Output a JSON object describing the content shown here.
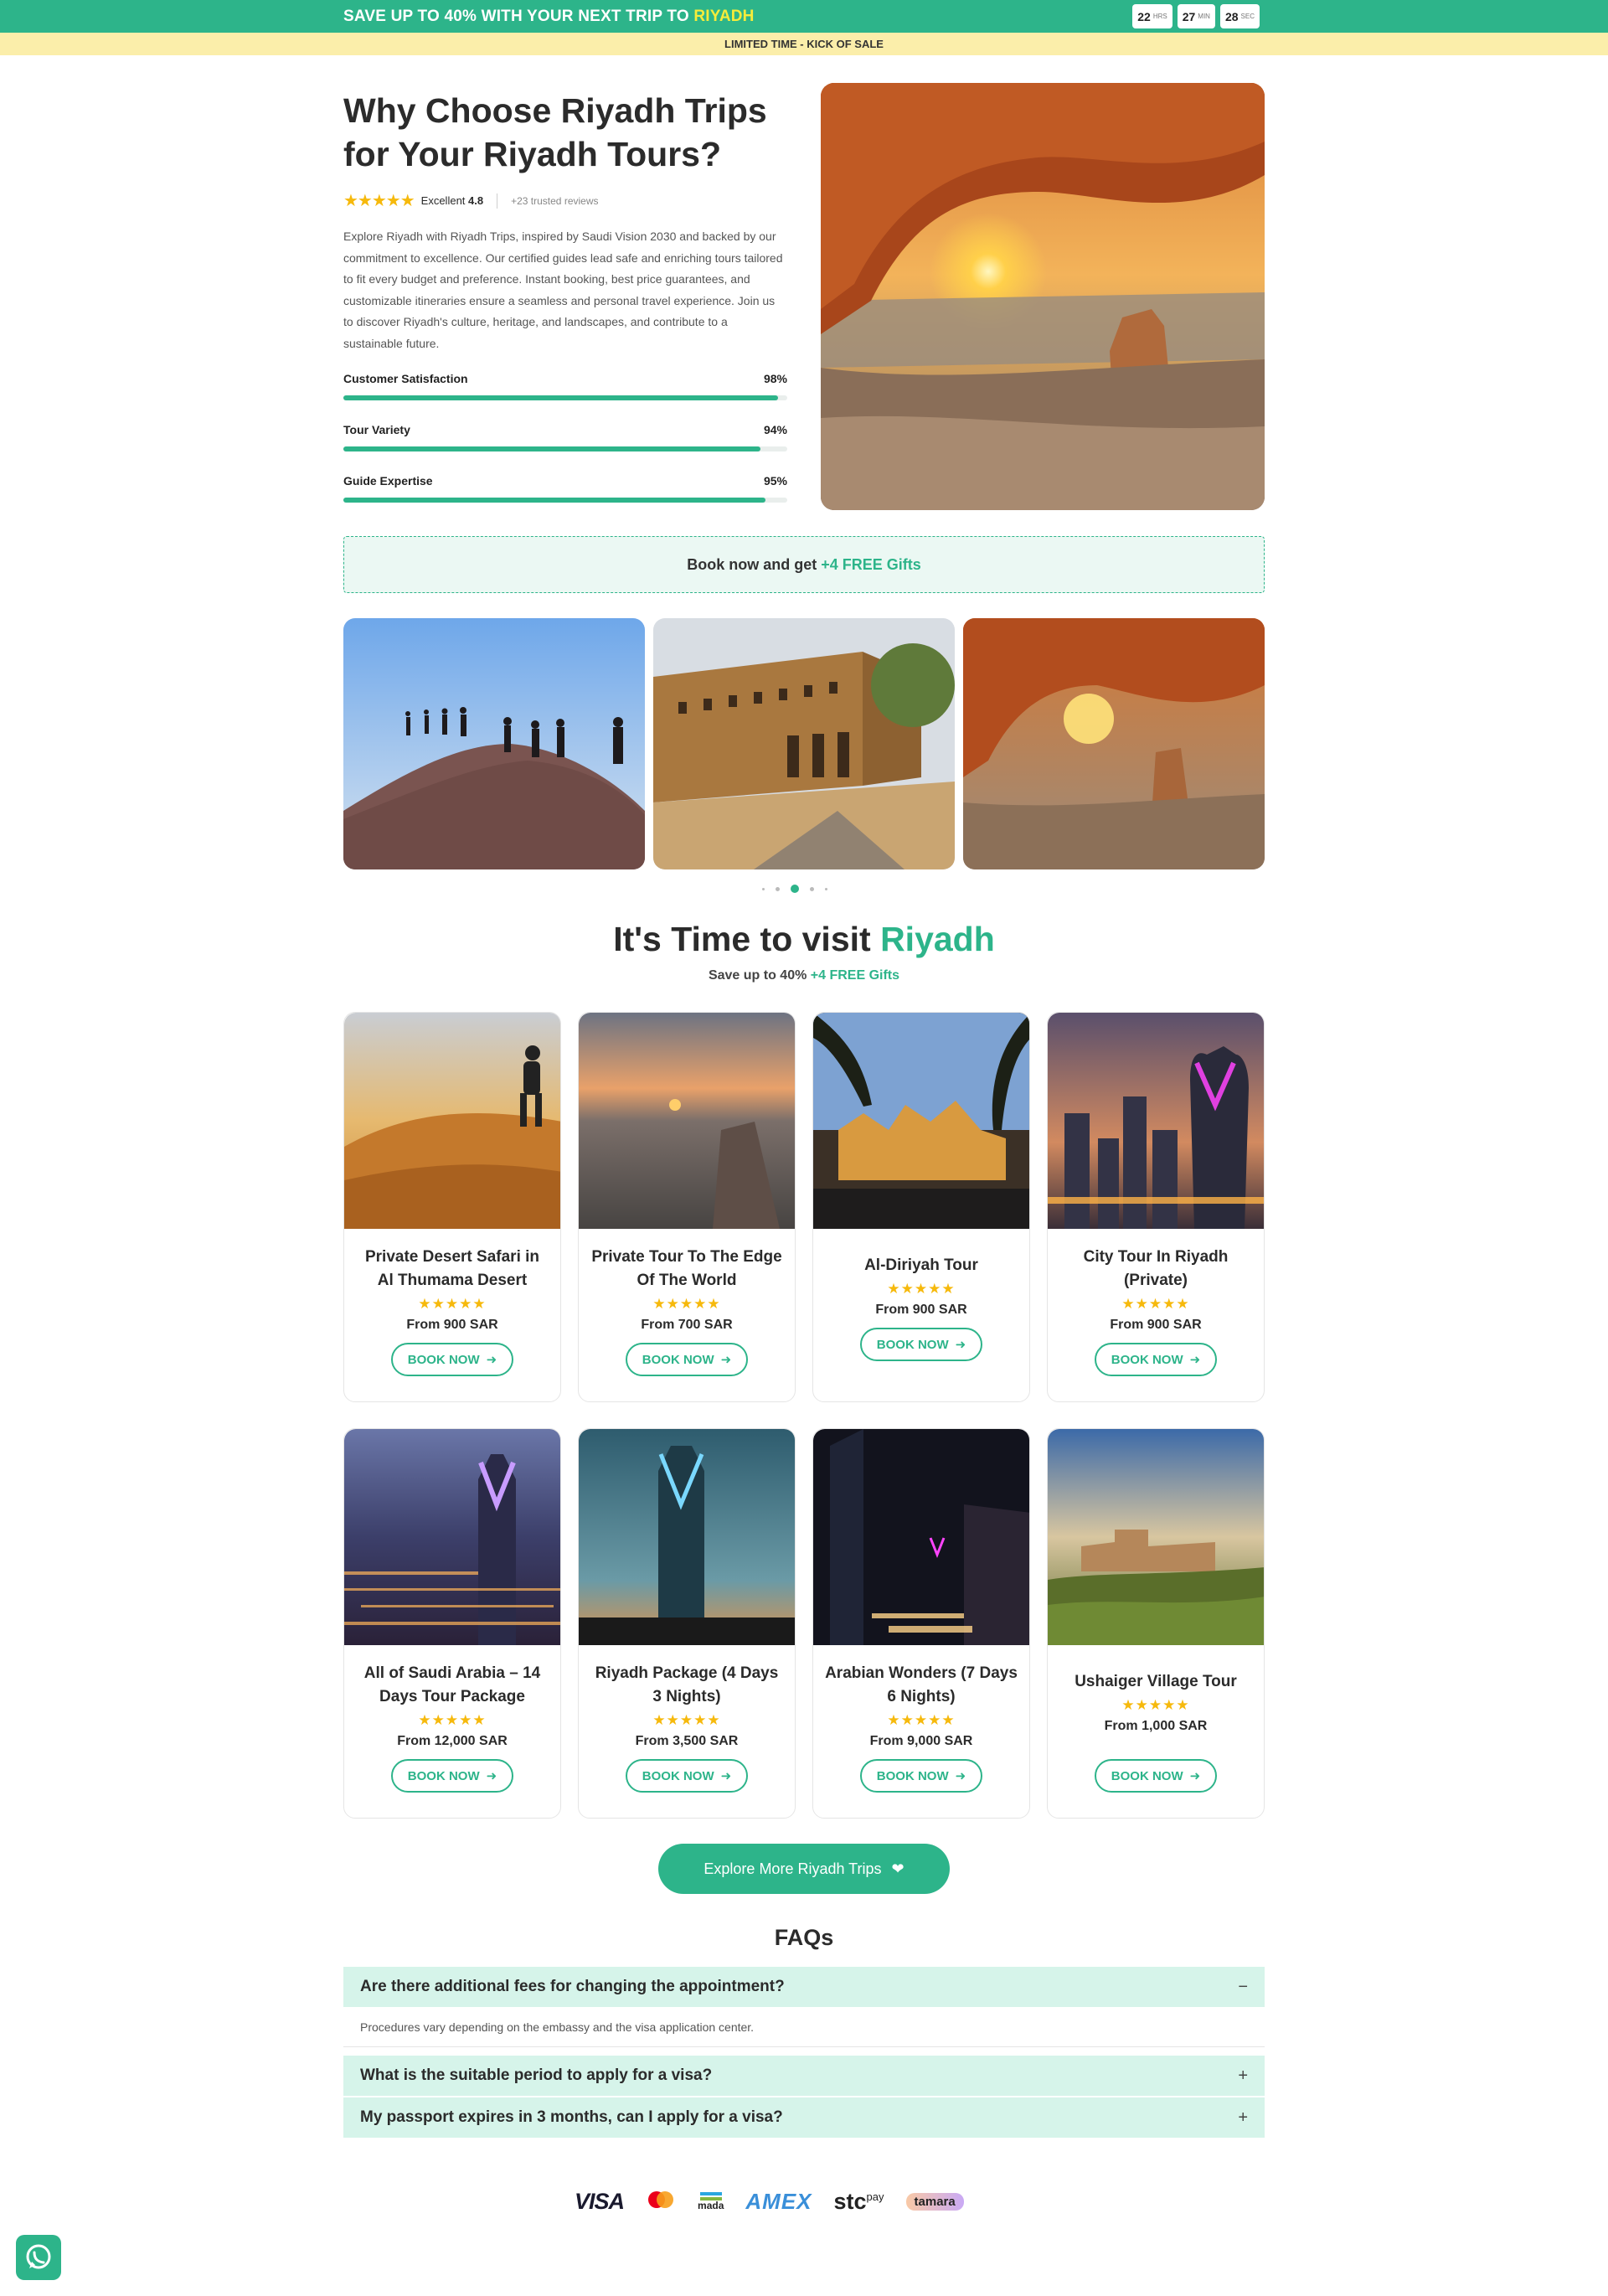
{
  "topbar": {
    "message_prefix": "SAVE UP TO 40% WITH YOUR NEXT TRIP TO",
    "message_highlight": "RIYADH",
    "countdown": [
      {
        "num": "22",
        "unit": "HRS"
      },
      {
        "num": "27",
        "unit": "MIN"
      },
      {
        "num": "28",
        "unit": "SEC"
      }
    ],
    "sub": "LIMITED TIME - KICK OF SALE"
  },
  "hero": {
    "title": "Why Choose Riyadh Trips for Your Riyadh Tours?",
    "rating_label": "Excellent",
    "rating_value": "4.8",
    "reviews": "+23 trusted reviews",
    "description": "Explore Riyadh with Riyadh Trips, inspired by Saudi Vision 2030 and backed by our commitment to excellence. Our certified guides lead safe and enriching tours tailored to fit every budget and preference. Instant booking, best price guarantees, and customizable itineraries ensure a seamless and personal travel experience. Join us to discover Riyadh's culture, heritage, and landscapes, and contribute to a sustainable future.",
    "stats": [
      {
        "label": "Customer Satisfaction",
        "value": "98%",
        "fraction": 0.98
      },
      {
        "label": "Tour Variety",
        "value": "94%",
        "fraction": 0.94
      },
      {
        "label": "Guide Expertise",
        "value": "95%",
        "fraction": 0.95
      }
    ]
  },
  "gift": {
    "prefix": "Book now and get",
    "accent": "+4 FREE Gifts"
  },
  "section": {
    "title_prefix": "It's Time to visit",
    "title_accent": "Riyadh",
    "sub_prefix": "Save up to 40%",
    "sub_accent": "+4 FREE Gifts"
  },
  "cards": [
    {
      "title": "Private Desert Safari in Al Thumama Desert",
      "stars": "★★★★★",
      "price": "From 900 SAR",
      "button": "BOOK NOW"
    },
    {
      "title": "Private Tour To The Edge Of The World",
      "stars": "★★★★★",
      "price": "From 700 SAR",
      "button": "BOOK NOW"
    },
    {
      "title": "Al-Diriyah Tour",
      "stars": "★★★★★",
      "price": "From 900 SAR",
      "button": "BOOK NOW"
    },
    {
      "title": "City Tour In Riyadh (Private)",
      "stars": "★★★★★",
      "price": "From 900 SAR",
      "button": "BOOK NOW"
    },
    {
      "title": "All of Saudi Arabia – 14 Days Tour Package",
      "stars": "★★★★★",
      "price": "From 12,000 SAR",
      "button": "BOOK NOW"
    },
    {
      "title": "Riyadh Package (4 Days 3 Nights)",
      "stars": "★★★★★",
      "price": "From 3,500 SAR",
      "button": "BOOK NOW"
    },
    {
      "title": "Arabian Wonders (7 Days 6 Nights)",
      "stars": "★★★★★",
      "price": "From 9,000 SAR",
      "button": "BOOK NOW"
    },
    {
      "title": "Ushaiger Village Tour",
      "stars": "★★★★★",
      "price": "From 1,000 SAR",
      "button": "BOOK NOW"
    }
  ],
  "explore": {
    "label": "Explore More Riyadh Trips"
  },
  "faq": {
    "title": "FAQs",
    "items": [
      {
        "q": "Are there additional fees for changing the appointment?",
        "a": "Procedures vary depending on the embassy and the visa application center.",
        "sign": "−"
      },
      {
        "q": "What is the suitable period to apply for a visa?",
        "sign": "+"
      },
      {
        "q": "My passport expires in 3 months, can I apply for a visa?",
        "sign": "+"
      }
    ]
  },
  "payments": {
    "visa": "VISA",
    "mada_ar": "مدى",
    "mada": "mada",
    "amex": "AMEX",
    "stc": "stc",
    "stc_pay": "pay",
    "tamara": "tamara"
  },
  "colors": {
    "accent": "#2db48a",
    "highlight": "#f6ec3a",
    "subbar": "#fbeeaa",
    "star": "#f6b90c"
  }
}
